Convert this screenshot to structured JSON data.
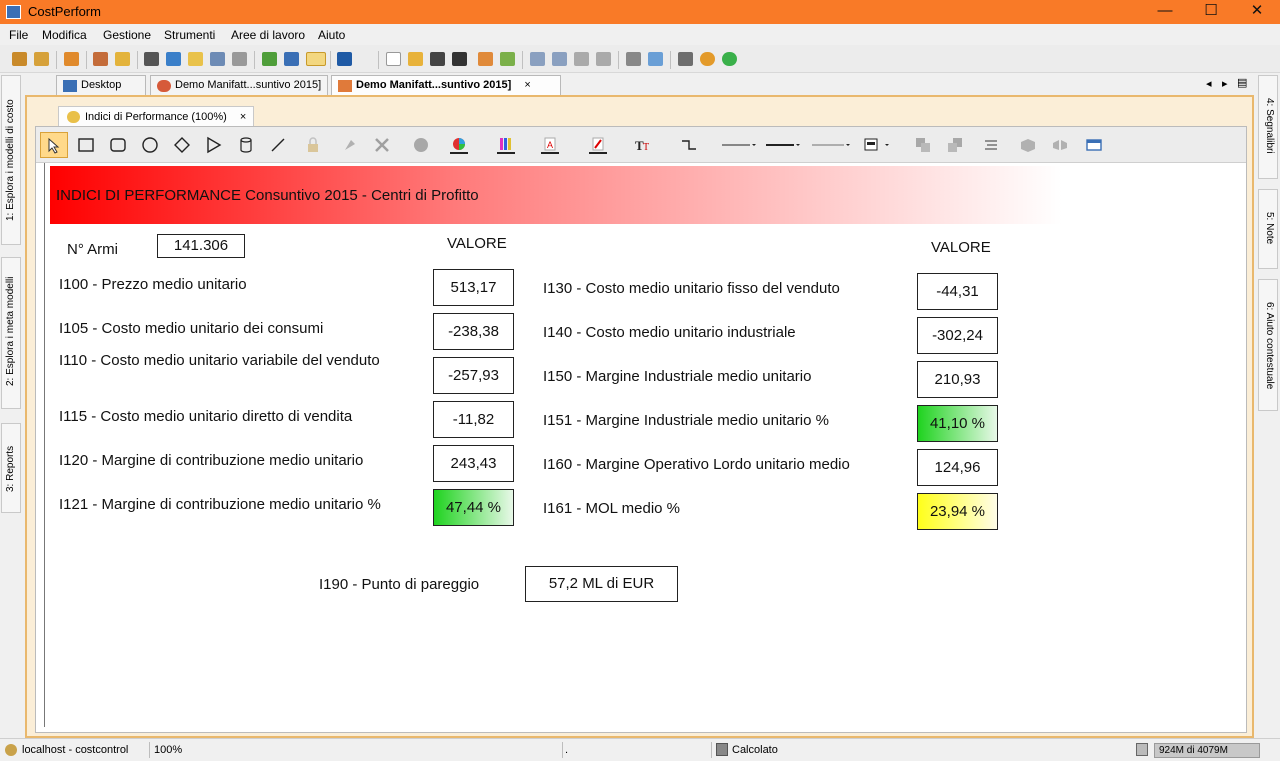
{
  "window": {
    "title": "CostPerform"
  },
  "menu": [
    "File",
    "Modifica",
    "Gestione",
    "Strumenti",
    "Aree di lavoro",
    "Aiuto"
  ],
  "left_tabs": [
    "1: Esplora i modelli di costo",
    "2: Esplora i meta modelli",
    "3: Reports"
  ],
  "right_tabs": [
    "4: Segnalibri",
    "5: Note",
    "6: Aiuto contestuale"
  ],
  "doc_tabs": [
    {
      "label": "Desktop"
    },
    {
      "label": "Demo Manifatt...suntivo 2015]"
    },
    {
      "label": "Demo Manifatt...suntivo 2015]"
    }
  ],
  "doc_tab_close": "×",
  "inner_tab": {
    "label": "Indici di Performance (100%)",
    "close": "×"
  },
  "nav_arrows": {
    "left": "◂",
    "right": "▸",
    "list": "▤"
  },
  "banner": "INDICI DI PERFORMANCE Consuntivo 2015 - Centri di Profitto",
  "armi": {
    "label": "N° Armi",
    "value": "141.306"
  },
  "valore_header": "VALORE",
  "left_metrics": [
    {
      "label": "I100 - Prezzo medio unitario",
      "value": "513,17"
    },
    {
      "label": "I105 - Costo medio unitario dei consumi",
      "value": "-238,38"
    },
    {
      "label": "I110 - Costo medio unitario variabile del venduto",
      "value": "-257,93"
    },
    {
      "label": "I115 - Costo medio unitario diretto di vendita",
      "value": "-11,82"
    },
    {
      "label": "I120 - Margine di contribuzione medio unitario",
      "value": "243,43"
    },
    {
      "label": "I121 - Margine di contribuzione medio unitario %",
      "value": "47,44 %"
    }
  ],
  "right_metrics": [
    {
      "label": "I130 - Costo medio unitario fisso del venduto",
      "value": "-44,31"
    },
    {
      "label": "I140 - Costo medio unitario industriale",
      "value": "-302,24"
    },
    {
      "label": "I150 - Margine Industriale medio unitario",
      "value": "210,93"
    },
    {
      "label": "I151 - Margine Industriale medio unitario %",
      "value": "41,10 %"
    },
    {
      "label": "I160 - Margine Operativo Lordo unitario medio",
      "value": "124,96"
    },
    {
      "label": "I161 - MOL medio %",
      "value": "23,94 %"
    }
  ],
  "breakeven": {
    "label": "I190 - Punto di pareggio",
    "value": "57,2 ML di EUR"
  },
  "status": {
    "connection": "localhost - costcontrol",
    "zoom": "100%",
    "dot": ".",
    "calc": "Calcolato",
    "memory": "924M di 4079M"
  },
  "colors": {
    "titlebar": "#f97a27",
    "frame": "#e9b86d",
    "green": "#1fd31f",
    "yellow": "#ffff1a",
    "banner_red": "#ff0000"
  }
}
